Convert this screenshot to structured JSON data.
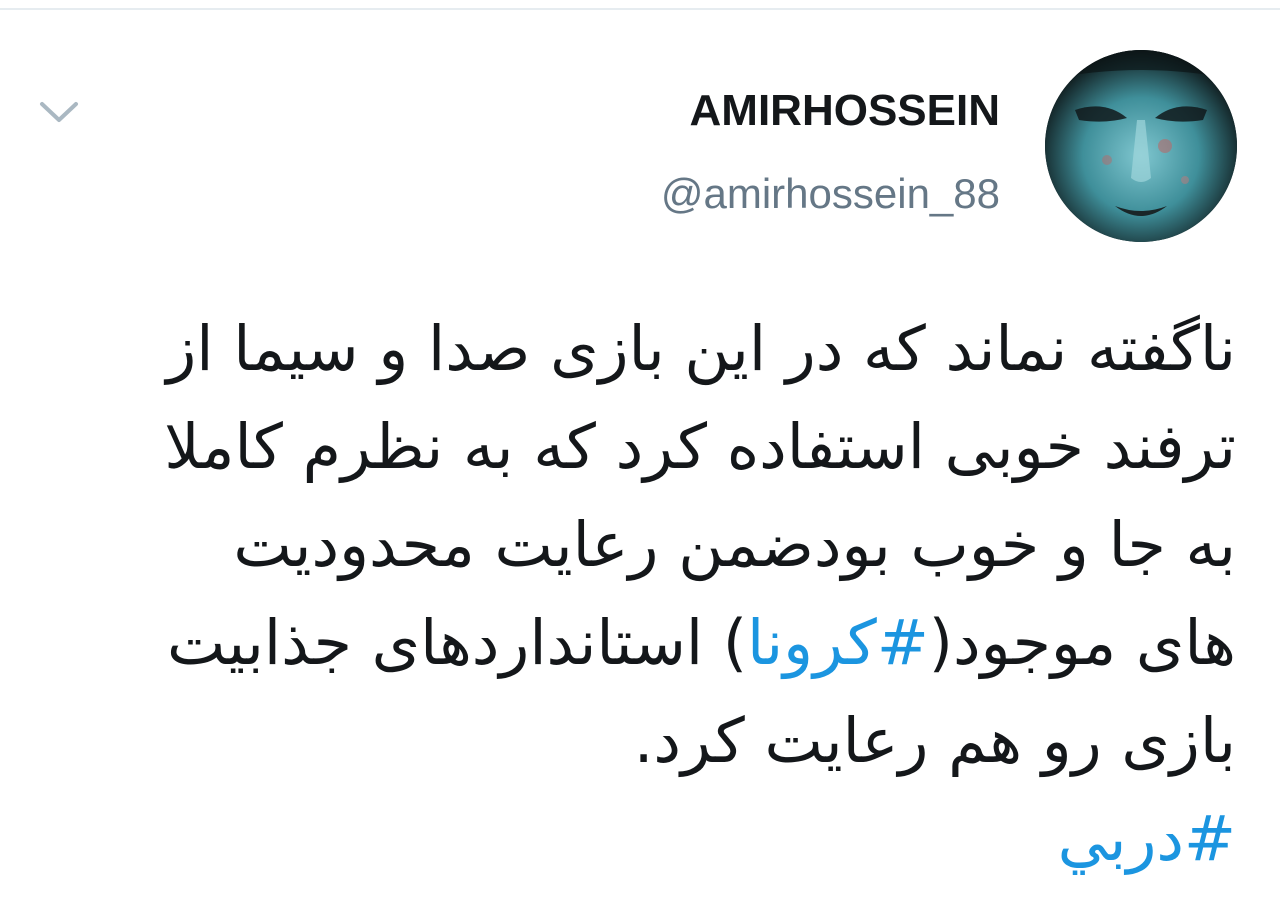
{
  "tweet": {
    "author": {
      "display_name": "AMIRHOSSEIN",
      "handle": "@amirhossein_88"
    },
    "text": {
      "line1": "ناگفته نماند که در این بازی صدا و سیما از",
      "line2": "ترفند خوبی استفاده کرد که به نظرم کاملا",
      "line3": "به جا و خوب بودضمن رعایت محدودیت",
      "line4_before": "های موجود(",
      "line4_hashtag": "#کرونا",
      "line4_after": ") استانداردهای جذابیت",
      "line5": "بازی رو هم رعایت کرد.",
      "line6_hashtag": "#دربي"
    }
  },
  "icons": {
    "menu": "chevron-down-icon",
    "avatar": "avatar"
  },
  "colors": {
    "text": "#14171a",
    "handle": "#657786",
    "hashtag": "#1b95e0",
    "caret": "#aab8c2",
    "divider": "#e6ecf0"
  }
}
